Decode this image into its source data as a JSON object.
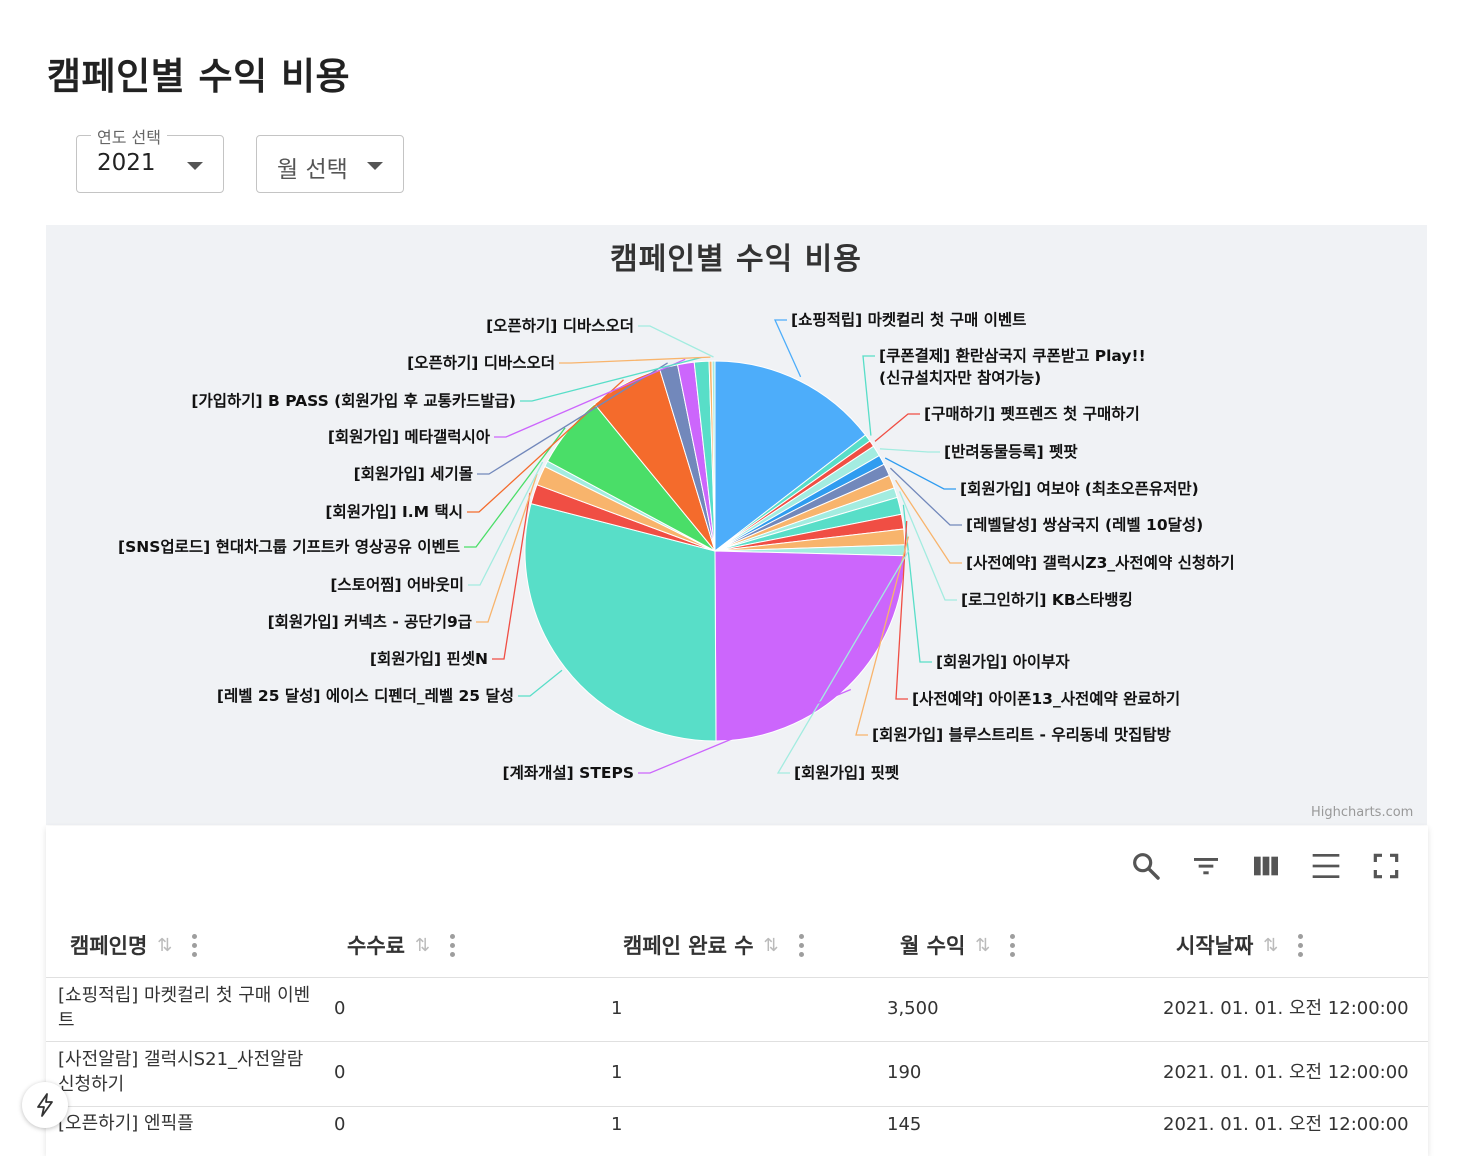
{
  "page": {
    "title": "캠페인별 수익 비용"
  },
  "filters": {
    "year_label": "연도 선택",
    "year_value": "2021",
    "month_placeholder": "월 선택"
  },
  "chart_data": {
    "type": "pie",
    "title": "캠페인별 수익 비용",
    "credits": "Highcharts.com",
    "labeled_slices": [
      {
        "name": "[쇼핑적립] 마켓컬리 첫 구매 이벤트",
        "value": 3500,
        "color": "#4dadfa"
      },
      {
        "name": "[쿠폰결제] 환란삼국지 쿠폰받고 Play!!",
        "name2": "(신규설치자만 참여가능)",
        "value": 150,
        "color": "#58dec8"
      },
      {
        "name": "[구매하기] 펫프렌즈 첫 구매하기",
        "value": 130,
        "color": "#f04e44"
      },
      {
        "name": "[반려동물등록] 펫팟",
        "value": 220,
        "color": "#a3ece0"
      },
      {
        "name": "[회원가입] 여보야 (최초오픈유저만)",
        "value": 200,
        "color": "#2f9cf0"
      },
      {
        "name": "[레벨달성] 쌍삼국지 (레벨 10달성)",
        "value": 250,
        "color": "#7288bb"
      },
      {
        "name": "[사전예약] 갤럭시Z3_사전예약 신청하기",
        "value": 270,
        "color": "#f8b46c"
      },
      {
        "name": "[로그인하기] KB스타뱅킹",
        "value": 200,
        "color": "#a3ece0"
      },
      {
        "name": "[회원가입] 아이부자",
        "value": 350,
        "color": "#58dec8"
      },
      {
        "name": "[사전예약] 아이폰13_사전예약 완료하기",
        "value": 300,
        "color": "#f04e44"
      },
      {
        "name": "[회원가입] 블루스트리트 - 우리동네 맛집탐방",
        "value": 320,
        "color": "#f8b46c"
      },
      {
        "name": "[회원가입] 핏펫",
        "value": 220,
        "color": "#a3ece0"
      },
      {
        "name": "[계좌개설] STEPS",
        "value": 5900,
        "color": "#cc66fc"
      },
      {
        "name": "[레벨 25 달성] 에이스 디펜더_레벨 25 달성",
        "value": 7000,
        "color": "#58dec8"
      },
      {
        "name": "[회원가입] 핀셋N",
        "value": 400,
        "color": "#f04e44"
      },
      {
        "name": "[회원가입] 커넥츠 - 공단기9급",
        "value": 400,
        "color": "#f8b46c"
      },
      {
        "name": "[스토어찜] 어바웃미",
        "value": 120,
        "color": "#a3ece0"
      },
      {
        "name": "[SNS업로드] 현대차그룹 기프트카 영상공유 이벤트",
        "value": 1500,
        "color": "#4ade68"
      },
      {
        "name": "[회원가입] I.M 택시",
        "value": 1500,
        "color": "#f46b2c"
      },
      {
        "name": "[회원가입] 세기몰",
        "value": 370,
        "color": "#7288bb"
      },
      {
        "name": "[회원가입] 메타갤럭시아",
        "value": 340,
        "color": "#cc66fc"
      },
      {
        "name": "[가입하기] B PASS (회원가입 후 교통카드발급)",
        "value": 300,
        "color": "#58dec8"
      },
      {
        "name": "[오픈하기] 디바스오더",
        "value": 60,
        "color": "#f8b46c"
      },
      {
        "name": "[오픈하기] 디바스오더",
        "value": 60,
        "color": "#a3ece0"
      }
    ]
  },
  "table": {
    "columns": [
      "캠페인명",
      "수수료",
      "캠페인 완료 수",
      "월 수익",
      "시작날짜"
    ],
    "rows": [
      {
        "name": "[쇼핑적립] 마켓컬리 첫 구매 이벤트",
        "fee": "0",
        "done": "1",
        "revenue": "3,500",
        "start": "2021. 01. 01. 오전 12:00:00"
      },
      {
        "name": "[사전알람] 갤럭시S21_사전알람 신청하기",
        "fee": "0",
        "done": "1",
        "revenue": "190",
        "start": "2021. 01. 01. 오전 12:00:00"
      },
      {
        "name": "[오픈하기] 엔픽플",
        "fee": "0",
        "done": "1",
        "revenue": "145",
        "start": "2021. 01. 01. 오전 12:00:00"
      }
    ]
  }
}
